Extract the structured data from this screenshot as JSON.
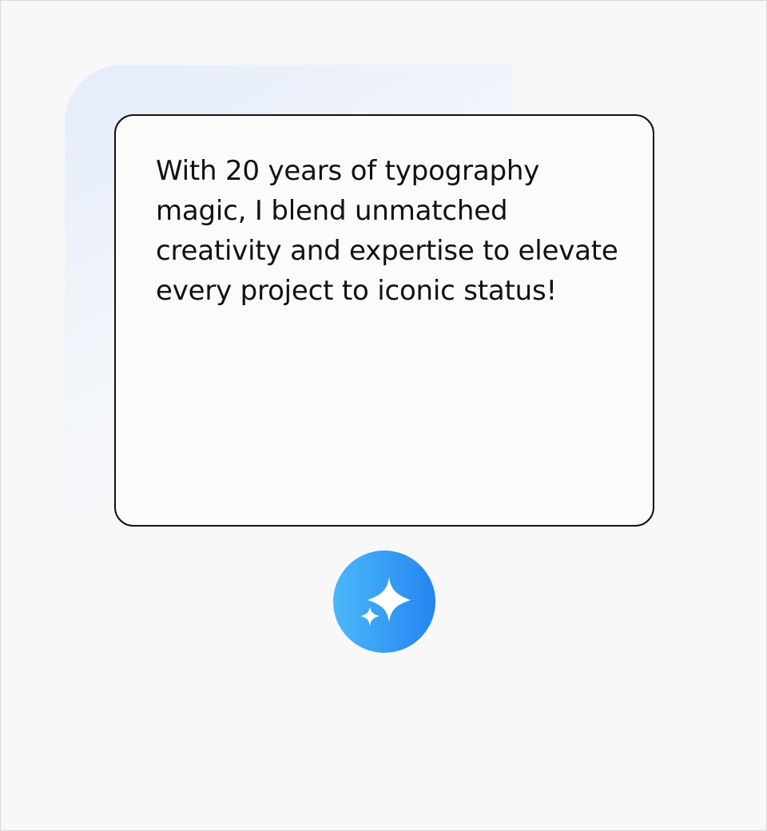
{
  "main": {
    "card": {
      "text": "With 20 years of typography magic, I blend unmatched creativity and expertise to elevate every project to iconic status!"
    },
    "ai_button": {
      "icon": "sparkle-icon",
      "gradient_start": "#4bb8f8",
      "gradient_end": "#2584f2"
    }
  }
}
